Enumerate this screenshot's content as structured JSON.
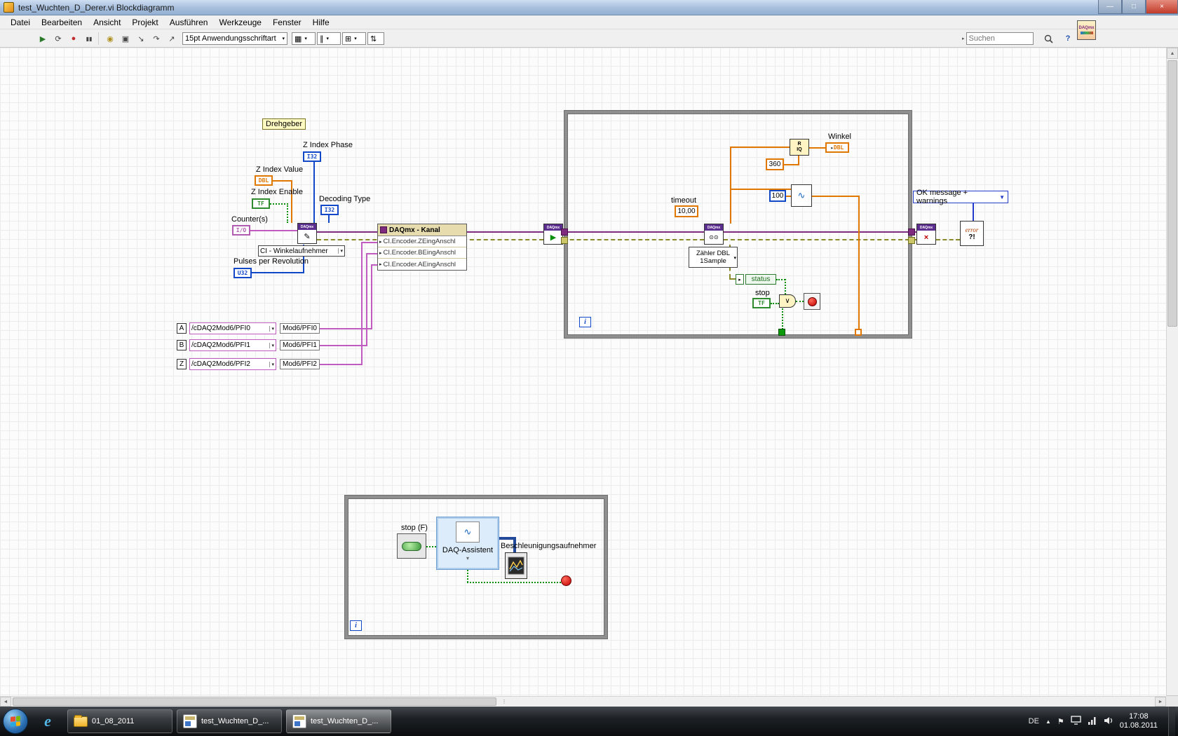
{
  "titlebar": {
    "title": "test_Wuchten_D_Derer.vi Blockdiagramm"
  },
  "menu": {
    "items": [
      "Datei",
      "Bearbeiten",
      "Ansicht",
      "Projekt",
      "Ausführen",
      "Werkzeuge",
      "Fenster",
      "Hilfe"
    ]
  },
  "toolbar": {
    "font_selector": "15pt Anwendungsschriftart",
    "search_placeholder": "Suchen"
  },
  "glyphs": {
    "daqmx": "DAQmx",
    "run": "▶",
    "run_cont": "⟳",
    "abort": "●",
    "pause": "▮▮",
    "bulb": "◉",
    "retain": "▣",
    "step_into": "↘",
    "step_over": "↷",
    "step_out": "↗",
    "dropdown": "▼",
    "dropdown_sm": "▾",
    "arrow": "▸",
    "or_gate": "∨",
    "min": "—",
    "max": "□",
    "close": "×",
    "help": "?",
    "scroll_up": "▲",
    "scroll_down": "▼",
    "scroll_left": "◄",
    "scroll_right": "►",
    "grip": "⋮",
    "align": "▦",
    "distribute": "∥",
    "resize": "⊞",
    "reorder": "⇅",
    "cleanup": "*",
    "sine": "∿",
    "glasses": "⊙⊙",
    "pencil": "✎",
    "start_green": "▶",
    "clear_x": "×",
    "r": "R",
    "iq": "IQ",
    "error_word": "error",
    "error_marks": "?!",
    "ie": "e",
    "tray_expand": "▲",
    "tray_flag": "⚑"
  },
  "diagram": {
    "free_label": "Drehgeber",
    "controls": {
      "z_index_phase": {
        "label": "Z Index Phase",
        "type": "I32"
      },
      "z_index_value": {
        "label": "Z Index Value",
        "type": "DBL"
      },
      "z_index_enable": {
        "label": "Z Index Enable",
        "type": "TF"
      },
      "counters": {
        "label": "Counter(s)",
        "type": "I/O"
      },
      "decoding_type": {
        "label": "Decoding Type",
        "type": "I32"
      },
      "pulses": {
        "label": "Pulses per Revolution",
        "type": "U32"
      }
    },
    "instance_combo": "CI - Winkelaufnehmer",
    "property_node": {
      "header": "DAQmx - Kanal",
      "rows": [
        "CI.Encoder.ZEingAnschl",
        "CI.Encoder.BEingAnschl",
        "CI.Encoder.AEingAnschl"
      ]
    },
    "channels": [
      {
        "letter": "A",
        "selector": "/cDAQ2Mod6/PFI0",
        "label": "Mod6/PFI0"
      },
      {
        "letter": "B",
        "selector": "/cDAQ2Mod6/PFI1",
        "label": "Mod6/PFI1"
      },
      {
        "letter": "Z",
        "selector": "/cDAQ2Mod6/PFI2",
        "label": "Mod6/PFI2"
      }
    ],
    "loop1": {
      "timeout_label": "timeout",
      "timeout_value": "10,00",
      "read_mode_line1": "Zähler DBL",
      "read_mode_line2": "1Sample",
      "const360": "360",
      "const100": "100",
      "winkel_label": "Winkel",
      "winkel_type": "DBL",
      "status": "status",
      "stop_label": "stop",
      "stop_type": "TF",
      "iteration": "i"
    },
    "error_mode": "OK message + warnings",
    "loop2": {
      "stop_label": "stop (F)",
      "express_label": "DAQ-Assistent",
      "graph_label": "Beschleunigungsaufnehmer",
      "iteration": "i"
    }
  },
  "taskbar": {
    "buttons": [
      "01_08_2011",
      "test_Wuchten_D_...",
      "test_Wuchten_D_..."
    ],
    "language": "DE",
    "time": "17:08",
    "date": "01.08.2011"
  }
}
